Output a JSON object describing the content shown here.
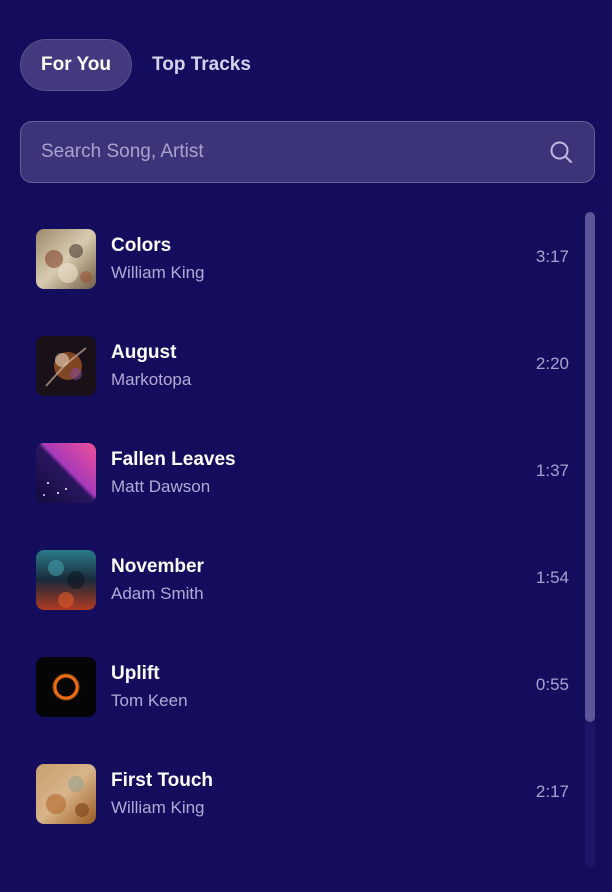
{
  "tabs": [
    {
      "label": "For You",
      "active": true
    },
    {
      "label": "Top Tracks",
      "active": false
    }
  ],
  "search": {
    "placeholder": "Search Song, Artist",
    "value": "",
    "icon": "search-icon"
  },
  "tracks": [
    {
      "title": "Colors",
      "artist": "William King",
      "duration": "3:17",
      "art": "abstract-beige-art"
    },
    {
      "title": "August",
      "artist": "Markotopa",
      "duration": "2:20",
      "art": "dark-orange-burst-art"
    },
    {
      "title": "Fallen Leaves",
      "artist": "Matt Dawson",
      "duration": "1:37",
      "art": "pink-purple-galaxy-art"
    },
    {
      "title": "November",
      "artist": "Adam Smith",
      "duration": "1:54",
      "art": "teal-red-texture-art"
    },
    {
      "title": "Uplift",
      "artist": "Tom Keen",
      "duration": "0:55",
      "art": "orange-ring-eclipse-art"
    },
    {
      "title": "First Touch",
      "artist": "William King",
      "duration": "2:17",
      "art": "orange-sandstone-art"
    }
  ],
  "scrollbar": {
    "position": 0.0,
    "visible_fraction": 0.78
  },
  "colors": {
    "background": "#140c5c",
    "active_tab": "#43397e",
    "search_bg": "#3c3478",
    "text_primary": "#ffffff",
    "text_secondary": "#b1abd6"
  }
}
